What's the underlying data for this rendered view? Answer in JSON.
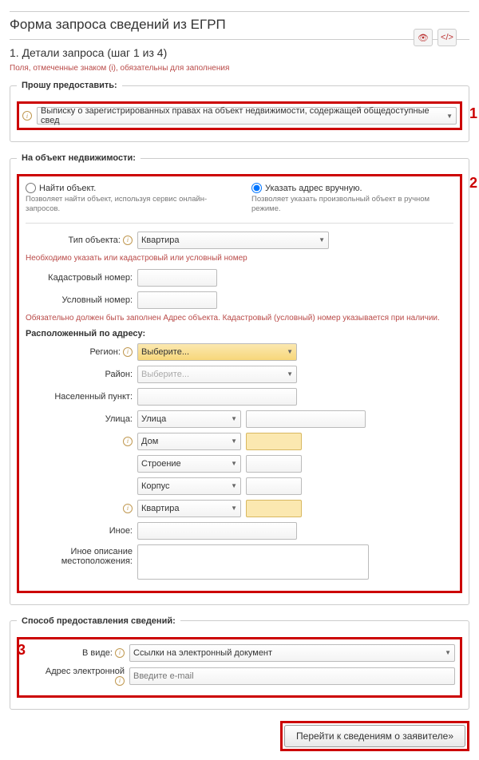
{
  "title": "Форма запроса сведений из ЕГРП",
  "step": "1. Детали запроса (шаг 1 из 4)",
  "required_note": "Поля, отмеченные знаком (i), обязательны для заполнения",
  "fs1": {
    "legend": "Прошу предоставить:",
    "doc_type": "Выписку о зарегистрированных правах на объект недвижимости, содержащей общедоступные свед"
  },
  "fs2": {
    "legend": "На объект недвижимости:",
    "radio_find": "Найти объект.",
    "radio_find_desc": "Позволяет найти объект, используя сервис онлайн-запросов.",
    "radio_manual": "Указать адрес вручную.",
    "radio_manual_desc": "Позволяет указать произвольный объект в ручном режиме.",
    "type_label": "Тип объекта:",
    "type_value": "Квартира",
    "warn1": "Необходимо указать или кадастровый или условный номер",
    "cad_label": "Кадастровый номер:",
    "cond_label": "Условный номер:",
    "warn2": "Обязательно должен быть заполнен Адрес объекта. Кадастровый (условный) номер указывается при наличии.",
    "addr_head": "Расположенный по адресу:",
    "region_label": "Регион:",
    "region_value": "Выберите...",
    "district_label": "Район:",
    "district_value": "Выберите...",
    "locality_label": "Населенный пункт:",
    "street_label": "Улица:",
    "street_value": "Улица",
    "house": "Дом",
    "building": "Строение",
    "corpus": "Корпус",
    "apartment": "Квартира",
    "other_label": "Иное:",
    "other_desc_label": "Иное описание местоположения:"
  },
  "fs3": {
    "legend": "Способ предоставления сведений:",
    "form_label": "В виде:",
    "form_value": "Ссылки на электронный документ",
    "email_label": "Адрес электронной",
    "email_placeholder": "Введите e-mail"
  },
  "btn": "Перейти к сведениям о заявителе»",
  "callouts": {
    "c1": "1",
    "c2": "2",
    "c3": "3"
  }
}
